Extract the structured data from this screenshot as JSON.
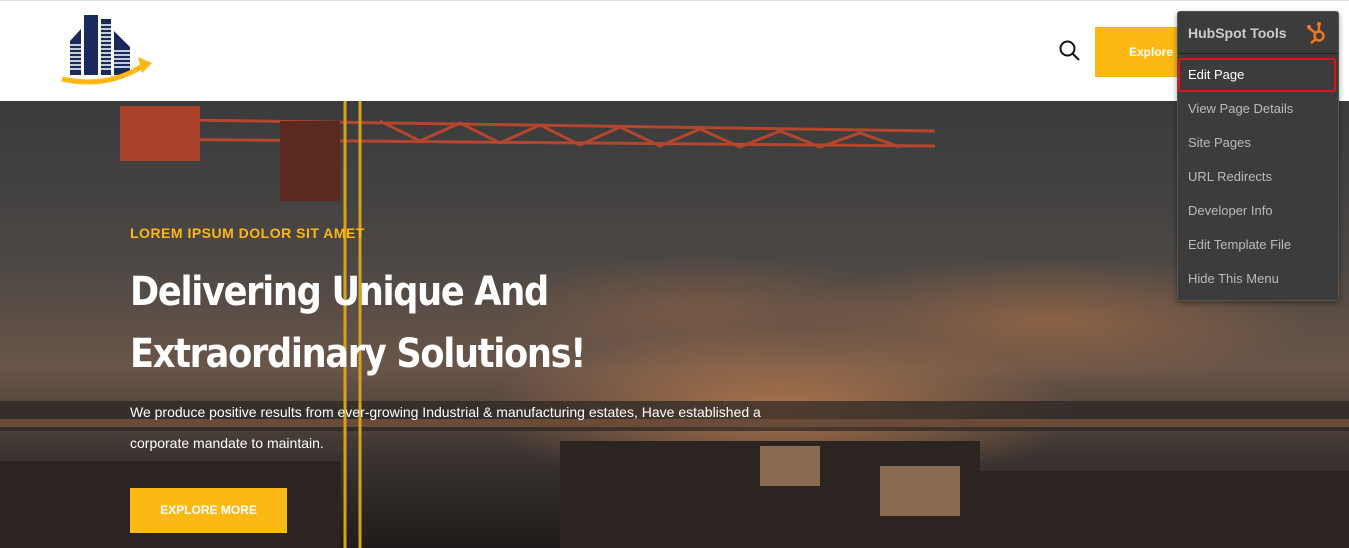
{
  "header": {
    "explore_button": "Explore E",
    "search_icon": "search-icon"
  },
  "hero": {
    "tagline": "LOREM IPSUM DOLOR SIT AMET",
    "title_line1": "Delivering Unique And",
    "title_line2": "Extraordinary Solutions!",
    "description": "We produce positive results from ever-growing Industrial & manufacturing estates, Have established a corporate mandate to maintain.",
    "button": "EXPLORE MORE"
  },
  "hubspot": {
    "title": "HubSpot Tools",
    "items": [
      "Edit Page",
      "View Page Details",
      "Site Pages",
      "URL Redirects",
      "Developer Info",
      "Edit Template File",
      "Hide This Menu"
    ],
    "accent": "#f57722"
  },
  "colors": {
    "brand_yellow": "#fdb813",
    "brand_navy": "#1b2a5c"
  }
}
